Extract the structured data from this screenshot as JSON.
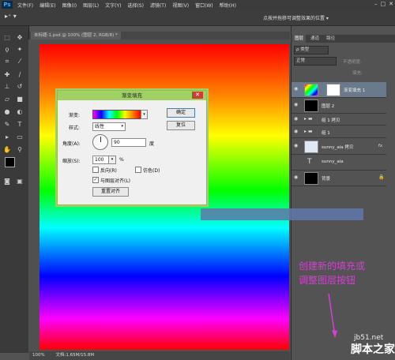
{
  "menubar": {
    "logo": "Ps",
    "items": [
      "文件(F)",
      "编辑(E)",
      "图像(I)",
      "图层(L)",
      "文字(Y)",
      "选择(S)",
      "滤镜(T)",
      "视图(V)",
      "窗口(W)",
      "帮助(H)"
    ]
  },
  "optionsbar": {
    "hint": "点按并拖移可调整效果的位置 ▾"
  },
  "document": {
    "tab_label": "未标题-1.psd @ 100% (图层 2, RGB/8) *"
  },
  "statusbar": {
    "zoom": "100%",
    "doc_info": "文档:1.65M/15.8M"
  },
  "dialog": {
    "title": "渐变填充",
    "gradient_label": "渐变:",
    "style_label": "样式:",
    "style_value": "线性",
    "angle_label": "角度(A):",
    "angle_value": "90",
    "angle_unit": "度",
    "scale_label": "缩放(S):",
    "scale_value": "100",
    "scale_unit": "%",
    "reverse_label": "反向(R)",
    "dither_label": "仿色(D)",
    "align_label": "与图层对齐(L)",
    "reset_align_button": "重置对齐",
    "ok_button": "确定",
    "reset_button": "复位",
    "close_glyph": "✕",
    "reverse_checked": false,
    "dither_checked": false,
    "align_checked": true
  },
  "panel": {
    "tabs": [
      "图层",
      "通道",
      "路径"
    ],
    "filter_label": "ρ 类型",
    "blend_mode": "正常",
    "opacity_label": "不透明度:",
    "fill_label": "填充:",
    "layers": [
      {
        "name": "渐变填充 1",
        "thumb": "gradient"
      },
      {
        "name": "图层 2",
        "thumb": "black"
      },
      {
        "name": "组 1 拷贝",
        "thumb": "folder"
      },
      {
        "name": "组 1",
        "thumb": "folder"
      },
      {
        "name": "sunny_aia 拷贝",
        "thumb": "text-image",
        "fx": "fx"
      },
      {
        "name": "sunny_aia",
        "thumb": "T"
      },
      {
        "name": "背景",
        "thumb": "black"
      }
    ]
  },
  "annotation": {
    "line1": "创建新的填充或",
    "line2": "调整图层按钮"
  },
  "watermark": {
    "site": "jb51.net",
    "brand": "脚本之家"
  },
  "colors": {
    "accent_dialog": "#9fd164",
    "annotation": "#d53fd5"
  }
}
